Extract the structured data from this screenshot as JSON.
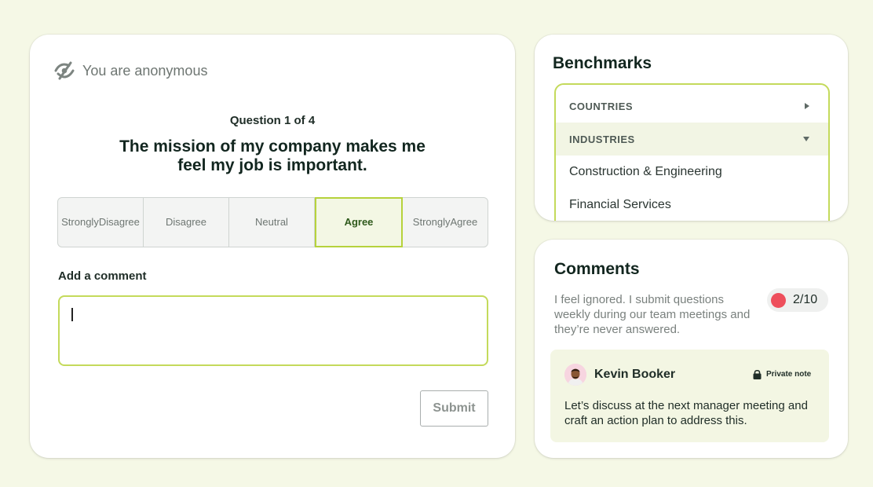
{
  "survey": {
    "anonymous_label": "You are anonymous",
    "question_counter": "Question 1 of 4",
    "question_text": "The mission of my company makes me feel my job is important.",
    "options": [
      "Strongly Disagree",
      "Disagree",
      "Neutral",
      "Agree",
      "Strongly Agree"
    ],
    "selected_option": "Agree",
    "comment_label": "Add a comment",
    "comment_value": "",
    "submit_label": "Submit"
  },
  "benchmarks": {
    "title": "Benchmarks",
    "categories": [
      {
        "label": "COUNTRIES",
        "expanded": false
      },
      {
        "label": "INDUSTRIES",
        "expanded": true
      }
    ],
    "industry_items": [
      "Construction & Engineering",
      "Financial Services"
    ]
  },
  "comments": {
    "title": "Comments",
    "comment_text": "I feel ignored. I submit questions weekly during our team meetings and they’re never answered.",
    "score": "2/10",
    "score_color": "#ee4f5c",
    "note": {
      "author": "Kevin Booker",
      "private_label": "Private note",
      "body": "Let’s discuss at the next manager meeting and craft an action plan to address this."
    }
  },
  "colors": {
    "background": "#f5f8e6",
    "accent": "#c4da5b",
    "selected_text": "#2f5a1c"
  },
  "icons": [
    "anonymous-eye-off-icon",
    "caret-right-icon",
    "caret-down-icon",
    "lock-icon"
  ]
}
